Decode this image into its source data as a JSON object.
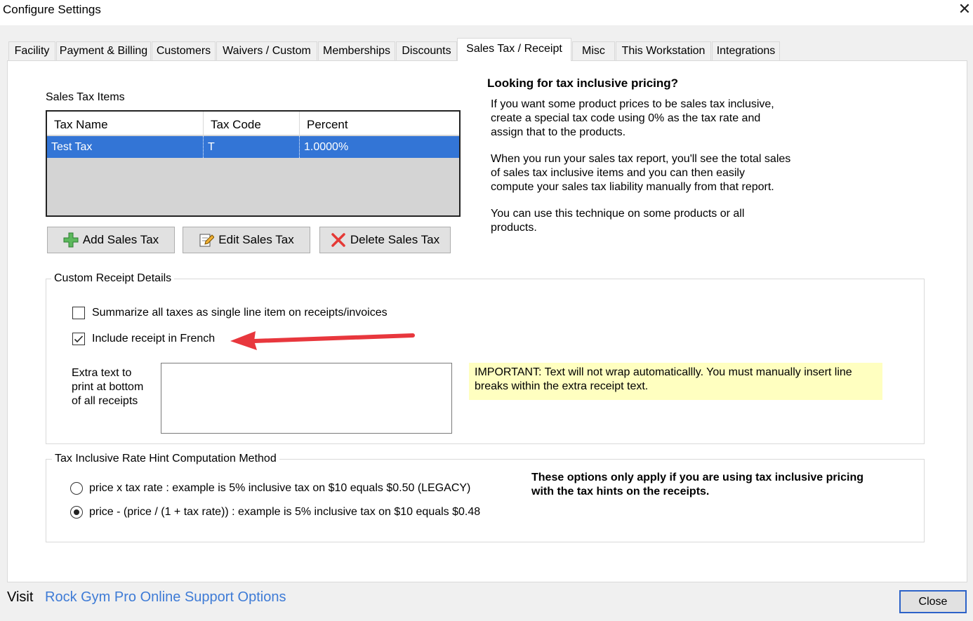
{
  "window": {
    "title": "Configure Settings",
    "close_glyph": "✕"
  },
  "tabs": [
    {
      "label": "Facility"
    },
    {
      "label": "Payment & Billing"
    },
    {
      "label": "Customers"
    },
    {
      "label": "Waivers / Custom"
    },
    {
      "label": "Memberships"
    },
    {
      "label": "Discounts"
    },
    {
      "label": "Sales Tax / Receipt"
    },
    {
      "label": "Misc"
    },
    {
      "label": "This Workstation"
    },
    {
      "label": "Integrations"
    }
  ],
  "sales_tax": {
    "section_label": "Sales Tax Items",
    "columns": [
      "Tax Name",
      "Tax Code",
      "Percent"
    ],
    "rows": [
      {
        "name": "Test Tax",
        "code": "T",
        "percent": "1.0000%"
      }
    ],
    "buttons": {
      "add": "Add Sales Tax",
      "edit": "Edit Sales Tax",
      "delete": "Delete Sales Tax"
    }
  },
  "tax_inclusive_info": {
    "heading": "Looking for tax inclusive pricing?",
    "para1": [
      "If you want some product prices to be sales tax inclusive,",
      "create a special tax code using 0% as the tax rate and",
      "assign that to the products."
    ],
    "para2": [
      "When you run your sales tax report, you'll see the total sales",
      "of sales tax inclusive items and you can then easily",
      "compute your sales tax liability manually from that report."
    ],
    "para3": [
      "You can use this technique on some products or all",
      "products."
    ]
  },
  "receipt": {
    "group_title": "Custom Receipt Details",
    "summarize_label": "Summarize all taxes as single line item on receipts/invoices",
    "french_label": "Include receipt in French",
    "extra_text_label": [
      "Extra text to",
      "print at bottom",
      "of all receipts"
    ],
    "extra_text_value": "",
    "important_lines": [
      "IMPORTANT:  Text will not wrap automaticallly.  You must manually insert line",
      "breaks within the extra receipt text."
    ],
    "annotation_color": "#e8373d"
  },
  "hint_method": {
    "group_title": "Tax Inclusive Rate Hint Computation Method",
    "option1": "price x tax rate : example is 5% inclusive tax on $10 equals $0.50 (LEGACY)",
    "option2": "price - (price / (1 + tax rate))  : example is 5% inclusive tax on $10 equals $0.48",
    "note_lines": [
      "These options only apply if you are using tax inclusive pricing",
      "with the tax hints on the receipts."
    ]
  },
  "footer": {
    "visit": "Visit",
    "link": "Rock Gym Pro Online Support Options",
    "close": "Close"
  }
}
